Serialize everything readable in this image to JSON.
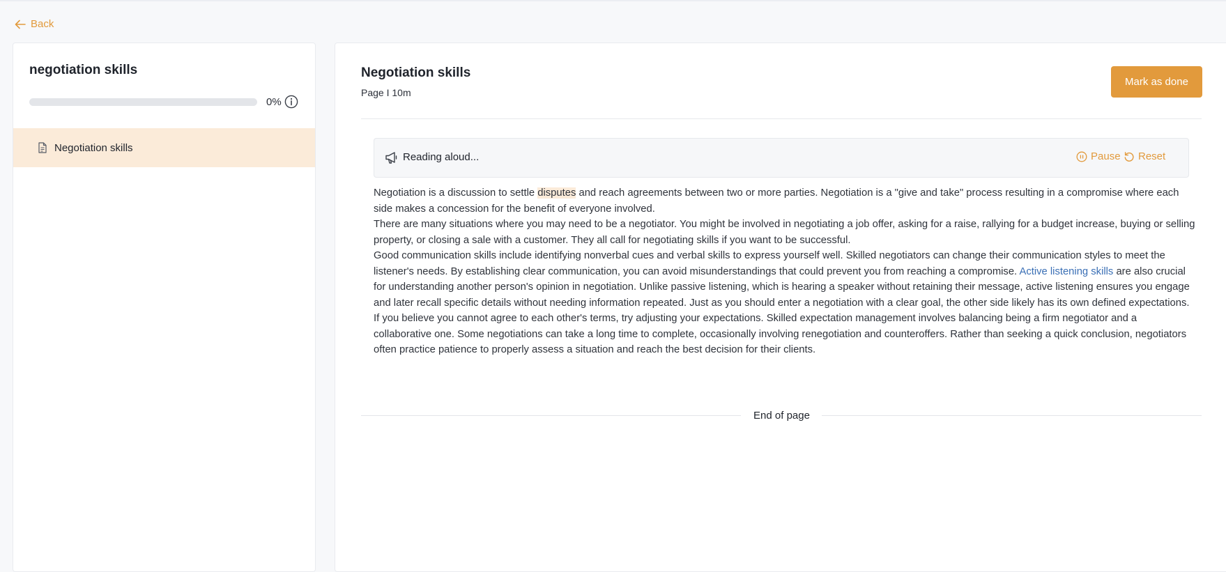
{
  "nav": {
    "back_label": "Back"
  },
  "sidebar": {
    "title": "negotiation skills",
    "progress": {
      "percent_value": 0,
      "percent_label": "0%"
    },
    "items": [
      {
        "label": "Negotiation skills",
        "icon": "document-icon",
        "active": true
      }
    ]
  },
  "page": {
    "title": "Negotiation skills",
    "meta": "Page I 10m",
    "mark_done_label": "Mark as done",
    "reader": {
      "status": "Reading aloud...",
      "pause_label": "Pause",
      "reset_label": "Reset"
    },
    "paragraphs": {
      "p1_before": "Negotiation is a discussion to settle ",
      "p1_highlight": "disputes",
      "p1_after": " and reach agreements between two or more parties. Negotiation is a \"give and take\" process resulting in a compromise where each side makes a concession for the benefit of everyone involved.",
      "p2": "There are many situations where you may need to be a negotiator. You might be involved in negotiating a job offer, asking for a raise, rallying for a budget increase, buying or selling property, or closing a sale with a customer. They all call for negotiating skills if you want to be successful.",
      "p3_before": "Good communication skills include identifying nonverbal cues and verbal skills to express yourself well. Skilled negotiators can change their communication styles to meet the listener's needs. By establishing clear communication, you can avoid misunderstandings that could prevent you from reaching a compromise. ",
      "p3_link": "Active listening skills",
      "p3_after": " are also crucial for understanding another person's opinion in negotiation. Unlike passive listening, which is hearing a speaker without retaining their message, active listening ensures you engage and later recall specific details without needing information repeated. Just as you should enter a negotiation with a clear goal, the other side likely has its own defined expectations. If you believe you cannot agree to each other's terms, try adjusting your expectations. Skilled expectation management involves balancing being a firm negotiator and a collaborative one. Some negotiations can take a long time to complete, occasionally involving renegotiation and counteroffers. Rather than seeking a quick conclusion, negotiators often practice patience to properly assess a situation and reach the best decision for their clients."
    },
    "end_label": "End of page"
  },
  "colors": {
    "accent": "#e29a3c",
    "highlight": "#fbebd9",
    "link": "#3a6fb5"
  }
}
